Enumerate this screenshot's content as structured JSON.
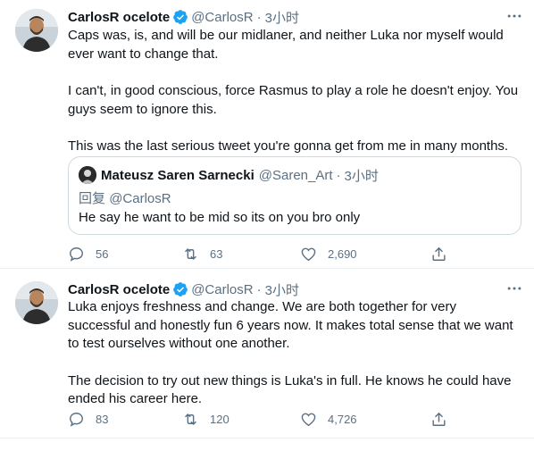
{
  "tweets": [
    {
      "author_name": "CarlosR ocelote",
      "handle": "@CarlosR",
      "separator": "·",
      "time": "3小时",
      "paragraphs": [
        "Caps was, is, and will be our midlaner, and neither Luka nor myself would ever want to change that.",
        "I can't, in good conscious, force Rasmus to play a role he doesn't enjoy. You guys seem to ignore this.",
        "This was the last serious tweet you're gonna get from me in many months."
      ],
      "quote": {
        "author_name": "Mateusz Saren Sarnecki",
        "handle": "@Saren_Art",
        "separator": "·",
        "time": "3小时",
        "reply_prefix": "回复",
        "reply_to": "@CarlosR",
        "text": "He say he want to be mid so its on you bro only"
      },
      "replies": "56",
      "retweets": "63",
      "likes": "2,690"
    },
    {
      "author_name": "CarlosR ocelote",
      "handle": "@CarlosR",
      "separator": "·",
      "time": "3小时",
      "paragraphs": [
        "Luka enjoys freshness and change. We are both together for very successful and honestly fun 6 years now. It makes total sense that we want to test ourselves without one another.",
        "The decision to try out new things is Luka's in full. He knows he could have ended his career here."
      ],
      "replies": "83",
      "retweets": "120",
      "likes": "4,726"
    }
  ],
  "colors": {
    "text": "#0f1419",
    "secondary": "#5b7083",
    "verified": "#1da1f2",
    "divider": "#ebeef0"
  }
}
